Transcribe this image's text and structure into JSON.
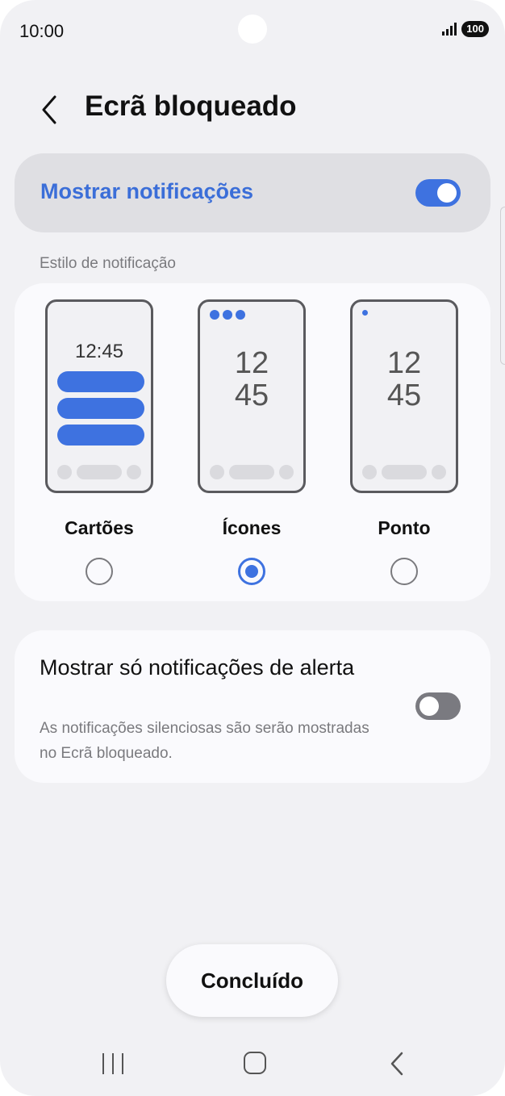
{
  "status_bar": {
    "time": "10:00",
    "battery": "100"
  },
  "header": {
    "title": "Ecrã bloqueado"
  },
  "master": {
    "label": "Mostrar notificações",
    "enabled": true
  },
  "section": {
    "label": "Estilo de notificação"
  },
  "styles": [
    {
      "label": "Cartões",
      "preview_time": "12:45",
      "selected": false
    },
    {
      "label": "Ícones",
      "preview_hours": "12",
      "preview_minutes": "45",
      "selected": true
    },
    {
      "label": "Ponto",
      "preview_hours": "12",
      "preview_minutes": "45",
      "selected": false
    }
  ],
  "alert_only": {
    "title": "Mostrar só notificações de alerta",
    "description": "As notificações silenciosas são serão mostradas no Ecrã bloqueado.",
    "enabled": false
  },
  "footer": {
    "done_label": "Concluído"
  },
  "colors": {
    "accent": "#3e72e0",
    "background": "#f1f1f4",
    "card": "#fafafd"
  }
}
